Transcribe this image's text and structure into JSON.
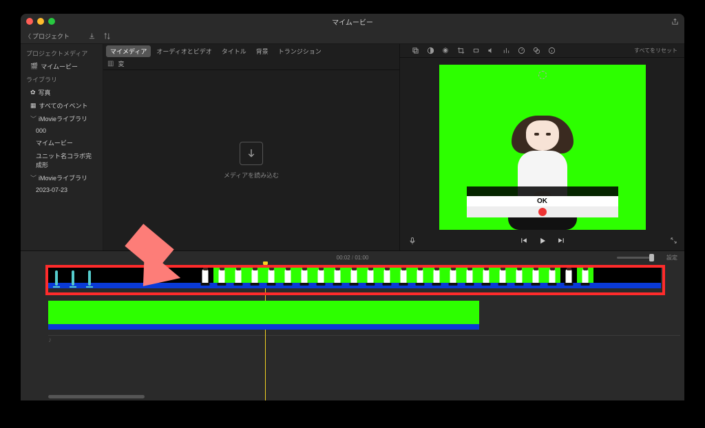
{
  "window": {
    "title": "マイムービー",
    "back_label": "プロジェクト"
  },
  "tabs": {
    "my_media": "マイメディア",
    "audio_video": "オーディオとビデオ",
    "titles": "タイトル",
    "backgrounds": "背景",
    "transitions": "トランジション"
  },
  "adjust": {
    "reset_all": "すべてをリセット"
  },
  "browser": {
    "header": "変",
    "import_label": "メディアを読み込む"
  },
  "sidebar": {
    "project_media_head": "プロジェクトメディア",
    "project_name": "マイムービー",
    "library_head": "ライブラリ",
    "photos": "写真",
    "all_events": "すべてのイベント",
    "lib1": "iMovieライブラリ",
    "lib1_items": [
      "000",
      "マイムービー",
      "ユニット名コラボ完成形"
    ],
    "lib2": "iMovieライブラリ",
    "lib2_items": [
      "2023-07-23"
    ]
  },
  "preview": {
    "ok_label": "OK"
  },
  "timeline": {
    "current": "00:02",
    "total": "01:00",
    "settings": "設定"
  }
}
